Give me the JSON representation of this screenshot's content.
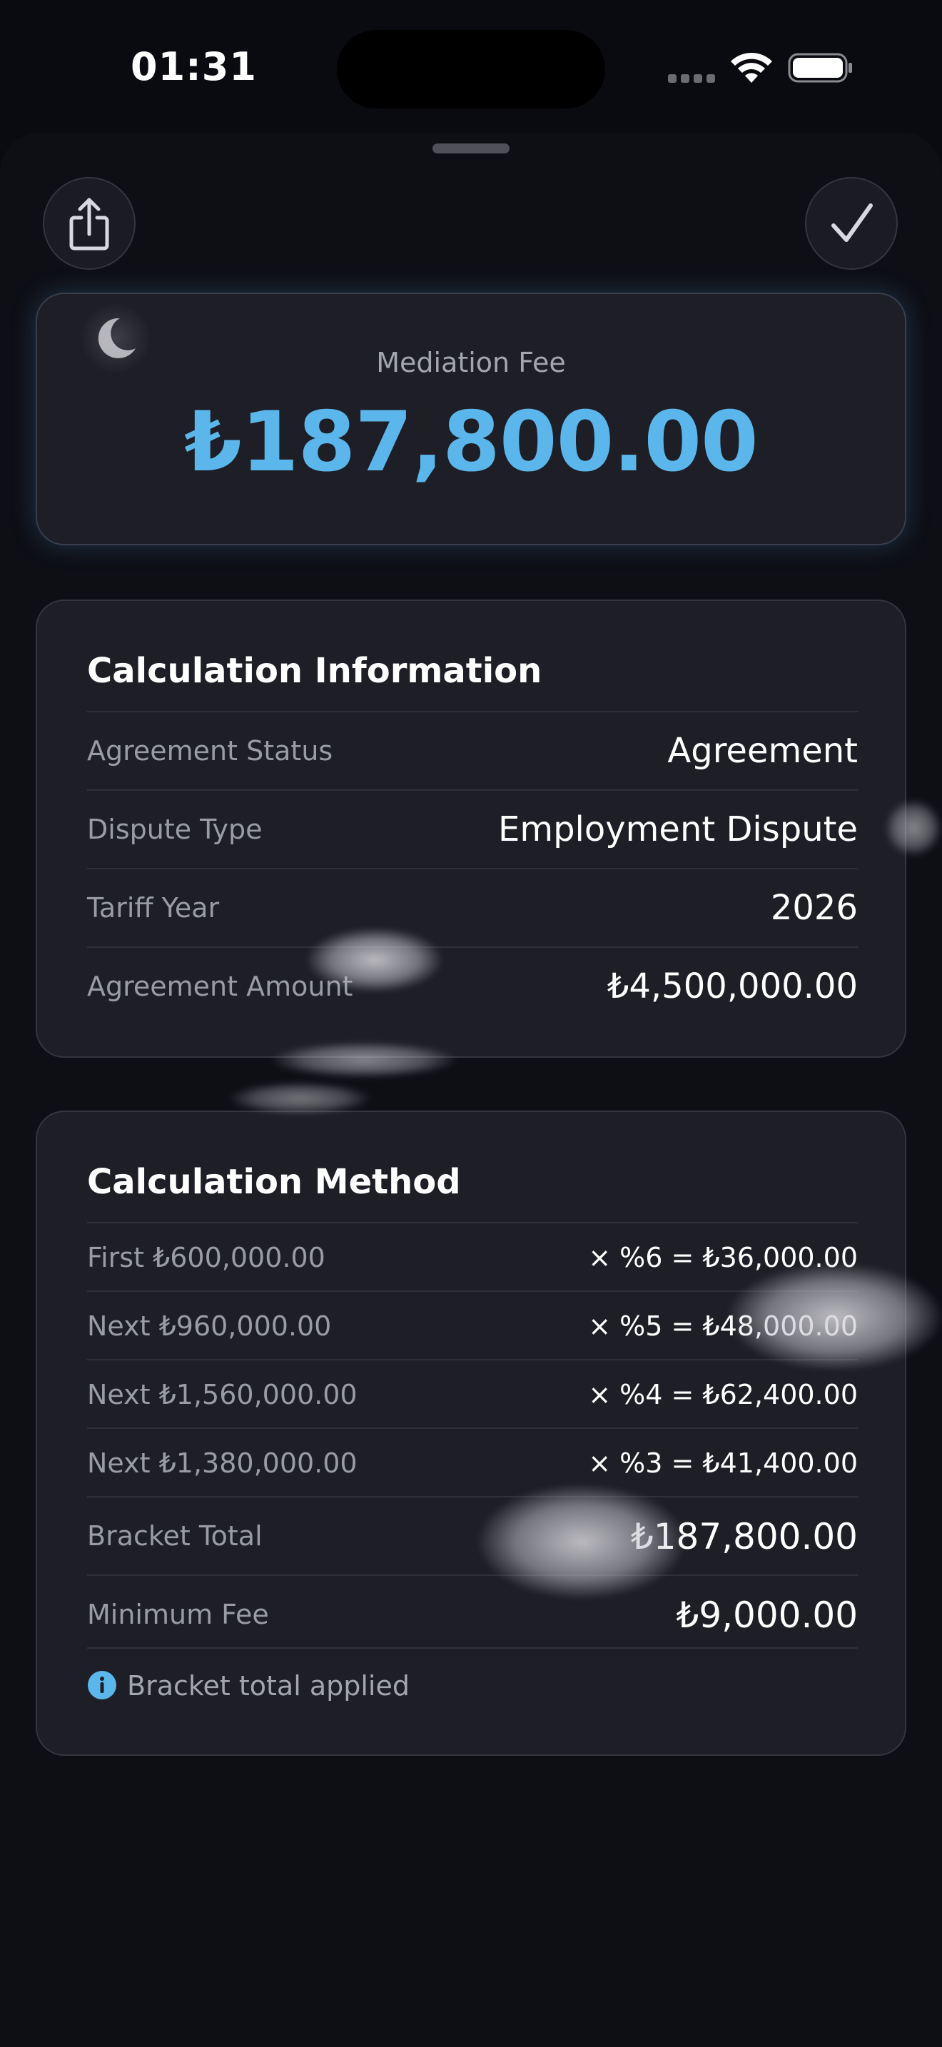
{
  "status_bar": {
    "time": "01:31"
  },
  "toolbar": {
    "share_icon": "square-and-arrow-up-icon",
    "done_icon": "checkmark-icon"
  },
  "fee": {
    "label": "Mediation Fee",
    "amount": "₺187,800.00",
    "accent_color": "#5bb6ec"
  },
  "calculation_info": {
    "title": "Calculation Information",
    "rows": [
      {
        "label": "Agreement Status",
        "value": "Agreement"
      },
      {
        "label": "Dispute Type",
        "value": "Employment Dispute"
      },
      {
        "label": "Tariff Year",
        "value": "2026"
      },
      {
        "label": "Agreement Amount",
        "value": "₺4,500,000.00"
      }
    ]
  },
  "calculation_method": {
    "title": "Calculation Method",
    "steps": [
      {
        "label": "First ₺600,000.00",
        "value": "× %6 = ₺36,000.00"
      },
      {
        "label": "Next ₺960,000.00",
        "value": "× %5 = ₺48,000.00"
      },
      {
        "label": "Next ₺1,560,000.00",
        "value": "× %4 = ₺62,400.00"
      },
      {
        "label": "Next ₺1,380,000.00",
        "value": "× %3 = ₺41,400.00"
      }
    ],
    "totals": [
      {
        "label": "Bracket Total",
        "value": "₺187,800.00"
      },
      {
        "label": "Minimum Fee",
        "value": "₺9,000.00"
      }
    ],
    "note": "Bracket total applied",
    "note_icon": "info-circle-icon"
  }
}
